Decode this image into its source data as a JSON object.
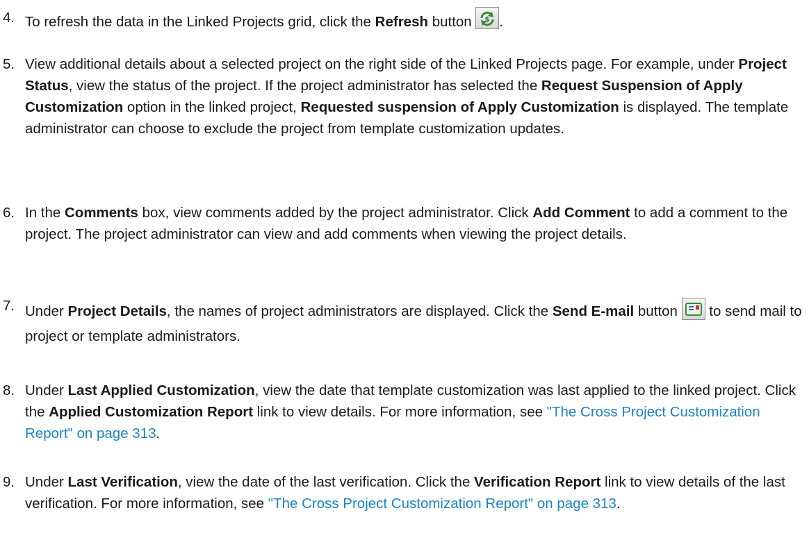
{
  "steps": [
    {
      "num": "4.",
      "parts": [
        {
          "t": "To refresh the data in the Linked Projects grid, click the "
        },
        {
          "t": "Refresh",
          "b": true
        },
        {
          "t": " button "
        },
        {
          "icon": "refresh-icon"
        },
        {
          "t": "."
        }
      ]
    },
    {
      "num": "5.",
      "parts": [
        {
          "t": "View additional details about a selected project on the right side of the Linked Projects page. For example, under "
        },
        {
          "t": "Project Status",
          "b": true
        },
        {
          "t": ", view the status of the project. If the project administrator has selected the "
        },
        {
          "t": "Request Suspension of Apply Customization",
          "b": true
        },
        {
          "t": " option in the linked project, "
        },
        {
          "t": "Requested suspension of Apply Customization",
          "b": true
        },
        {
          "t": " is displayed. The template administrator can choose to exclude the project from template customization updates."
        }
      ]
    },
    {
      "num": "6.",
      "parts": [
        {
          "t": "In the "
        },
        {
          "t": "Comments",
          "b": true
        },
        {
          "t": " box, view comments added by the project administrator. Click "
        },
        {
          "t": "Add Comment",
          "b": true
        },
        {
          "t": " to add a comment to the project. The project administrator can view and add comments when viewing the project details."
        }
      ]
    },
    {
      "num": "7.",
      "parts": [
        {
          "t": "Under "
        },
        {
          "t": "Project Details",
          "b": true
        },
        {
          "t": ", the names of project administrators are displayed. Click the "
        },
        {
          "t": "Send E-mail",
          "b": true
        },
        {
          "t": " button "
        },
        {
          "icon": "send-email-icon"
        },
        {
          "t": " to send mail to project or template administrators."
        }
      ]
    },
    {
      "num": "8.",
      "parts": [
        {
          "t": "Under "
        },
        {
          "t": "Last Applied Customization",
          "b": true
        },
        {
          "t": ", view the date that template customization was last applied to the linked project. Click the "
        },
        {
          "t": "Applied Customization Report",
          "b": true
        },
        {
          "t": " link to view details. For more information, see "
        },
        {
          "t": "\"The Cross Project Customization Report\" on page 313",
          "link": true
        },
        {
          "t": "."
        }
      ]
    },
    {
      "num": "9.",
      "parts": [
        {
          "t": "Under "
        },
        {
          "t": "Last Verification",
          "b": true
        },
        {
          "t": ", view the date of the last verification. Click the "
        },
        {
          "t": "Verification Report",
          "b": true
        },
        {
          "t": " link to view details of the last verification. For more information, see "
        },
        {
          "t": "\"The Cross Project Customization Report\" on page 313",
          "link": true
        },
        {
          "t": "."
        }
      ]
    }
  ]
}
